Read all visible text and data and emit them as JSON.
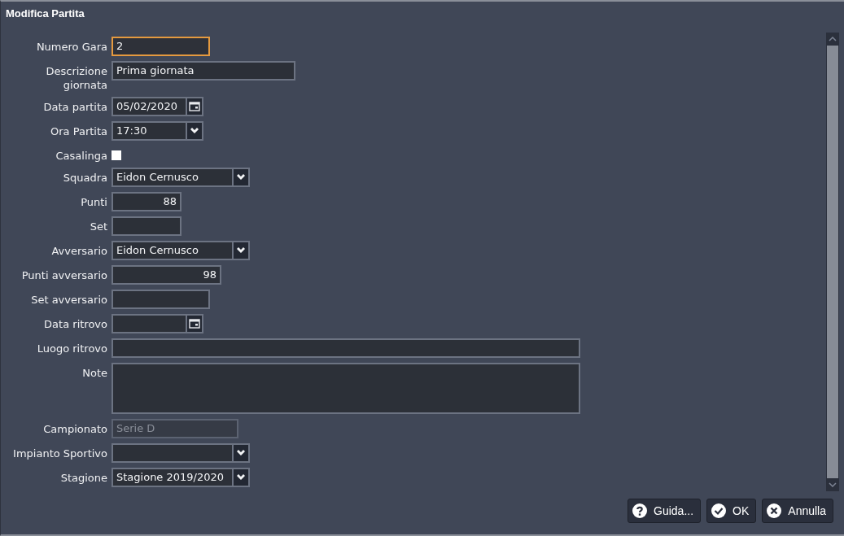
{
  "window": {
    "title": "Modifica Partita"
  },
  "fields": [
    {
      "label": "Numero Gara",
      "kind": "text",
      "value": "2",
      "focused": true,
      "disabled": false
    },
    {
      "label": "Descrizione giornata",
      "kind": "text",
      "value": "Prima giornata",
      "focused": false,
      "disabled": false
    },
    {
      "label": "Data partita",
      "kind": "date",
      "value": "05/02/2020",
      "focused": false,
      "disabled": false
    },
    {
      "label": "Ora Partita",
      "kind": "select",
      "value": "17:30",
      "focused": false,
      "disabled": false
    },
    {
      "label": "Casalinga",
      "kind": "checkbox",
      "checked": false,
      "focused": false,
      "disabled": false
    },
    {
      "label": "Squadra",
      "kind": "select",
      "value": "Eidon Cernusco",
      "focused": false,
      "disabled": false
    },
    {
      "label": "Punti",
      "kind": "number",
      "value": "88",
      "focused": false,
      "disabled": false
    },
    {
      "label": "Set",
      "kind": "number",
      "focused": false,
      "disabled": false
    },
    {
      "label": "Avversario",
      "kind": "select",
      "value": "Eidon Cernusco",
      "focused": false,
      "disabled": false
    },
    {
      "label": "Punti avversario",
      "kind": "number",
      "value": "98",
      "focused": false,
      "disabled": false
    },
    {
      "label": "Set avversario",
      "kind": "number",
      "focused": false,
      "disabled": false
    },
    {
      "label": "Data ritrovo",
      "kind": "date",
      "focused": false,
      "disabled": false
    },
    {
      "label": "Luogo ritrovo",
      "kind": "text",
      "focused": false,
      "disabled": false
    },
    {
      "label": "Note",
      "kind": "textarea",
      "focused": false,
      "disabled": false
    },
    {
      "label": "Campionato",
      "kind": "text",
      "value": "Serie D",
      "focused": false,
      "disabled": true
    },
    {
      "label": "Impianto Sportivo",
      "kind": "select",
      "focused": false,
      "disabled": false
    },
    {
      "label": "Stagione",
      "kind": "select",
      "value": "Stagione 2019/2020",
      "focused": false,
      "disabled": false
    }
  ],
  "buttons": [
    {
      "label": "Guida...",
      "kind": "help"
    },
    {
      "label": "OK",
      "kind": "ok"
    },
    {
      "label": "Annulla",
      "kind": "cancel"
    }
  ]
}
